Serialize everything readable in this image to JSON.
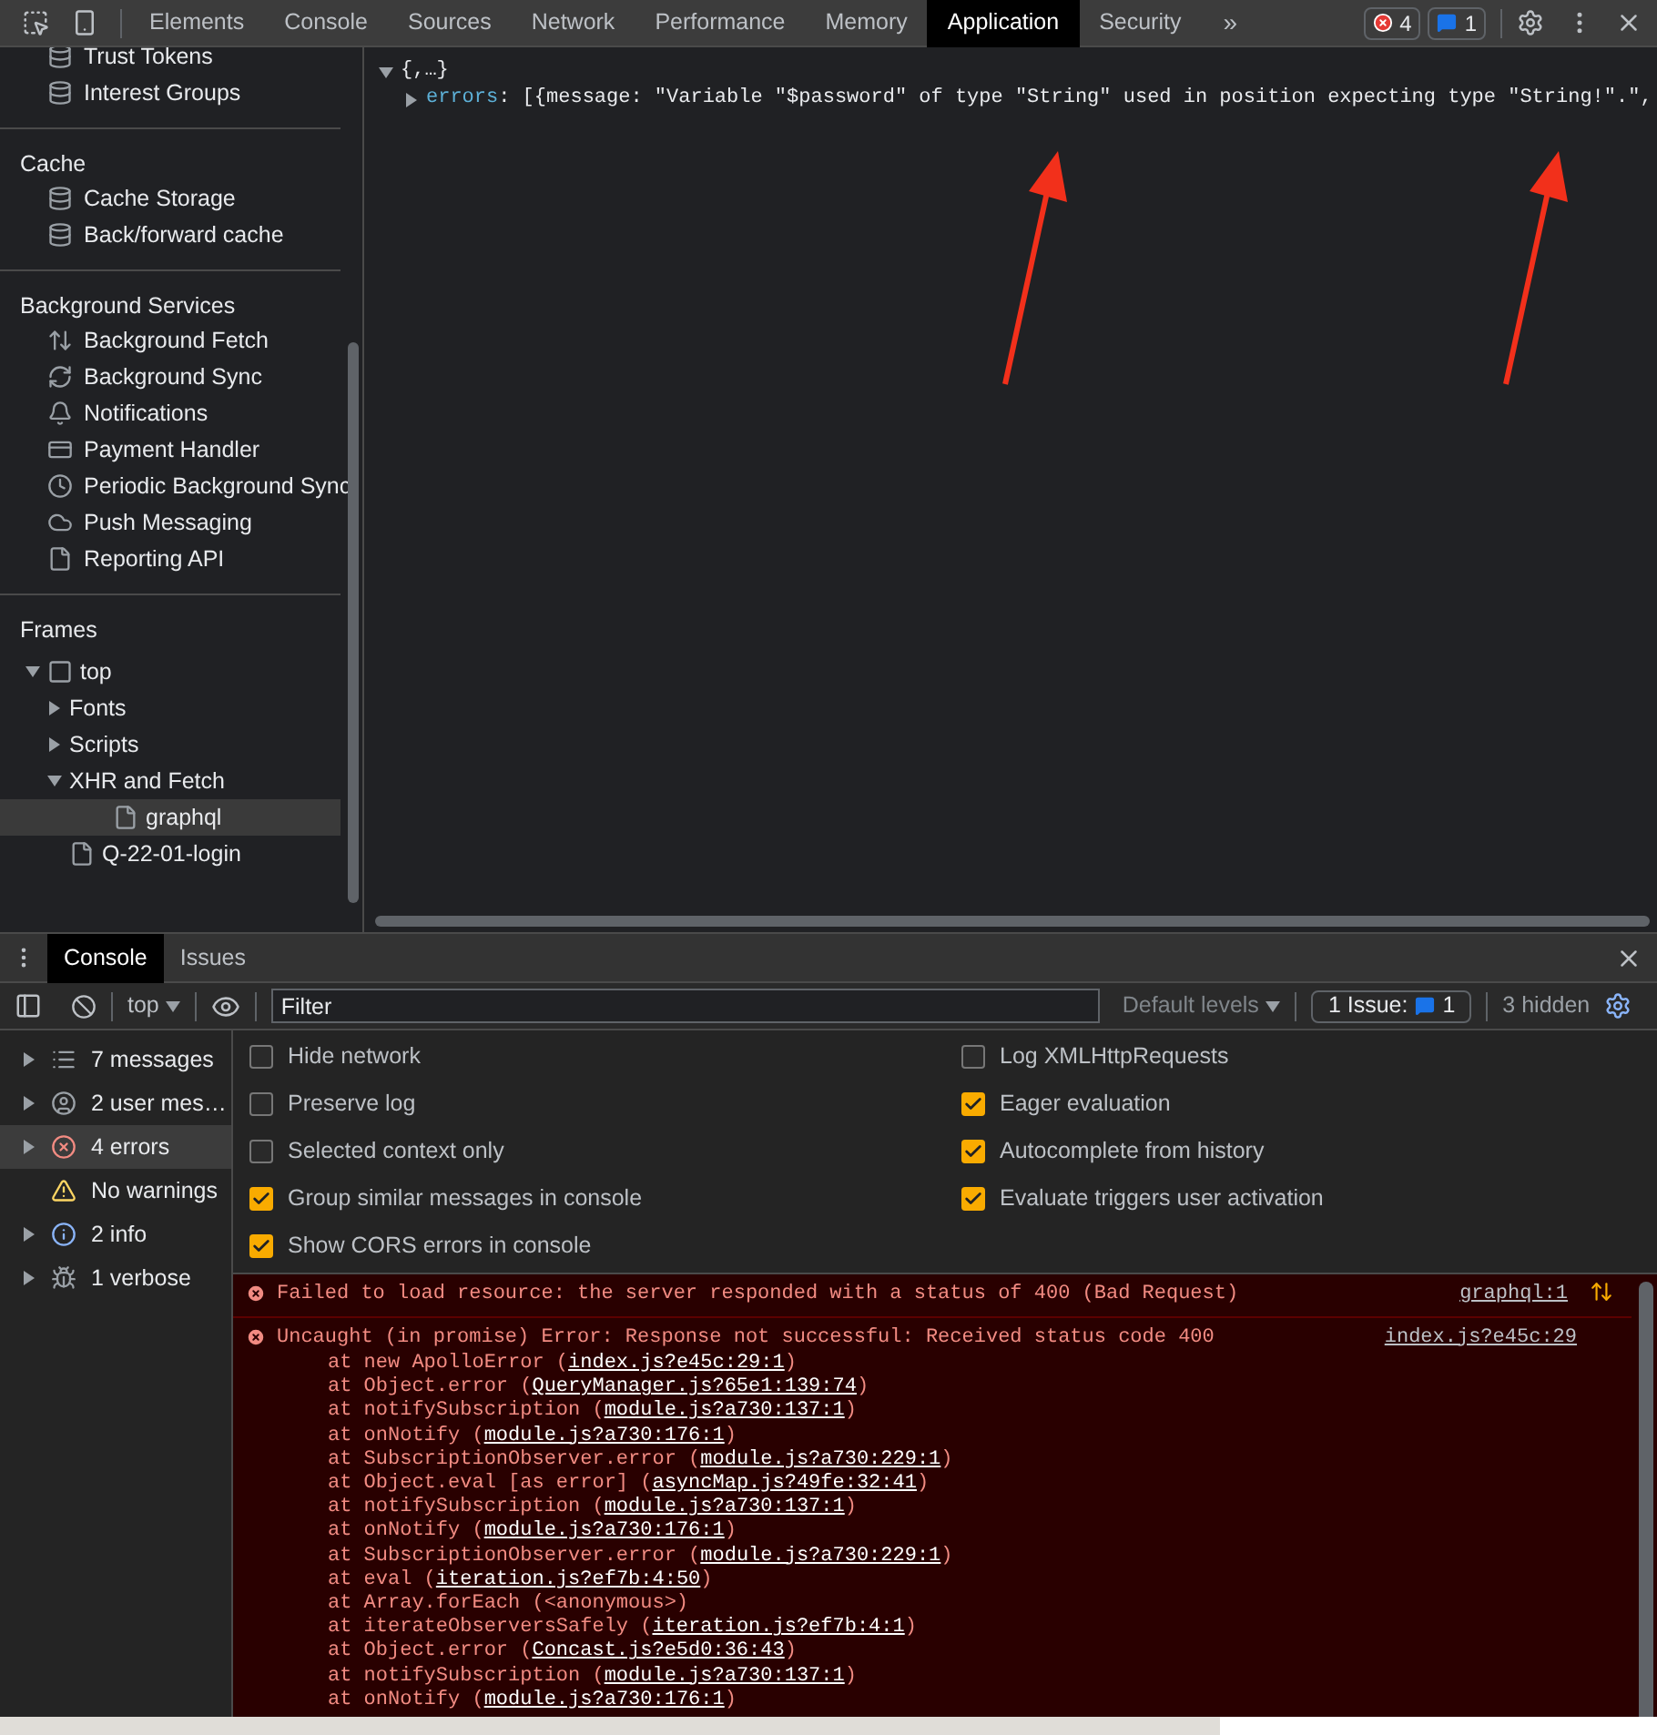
{
  "toolbar": {
    "tabs": [
      {
        "label": "Elements",
        "selected": false
      },
      {
        "label": "Console",
        "selected": false
      },
      {
        "label": "Sources",
        "selected": false
      },
      {
        "label": "Network",
        "selected": false
      },
      {
        "label": "Performance",
        "selected": false
      },
      {
        "label": "Memory",
        "selected": false
      },
      {
        "label": "Application",
        "selected": true
      },
      {
        "label": "Security",
        "selected": false
      }
    ],
    "more": "»",
    "error_count": "4",
    "issue_count": "1"
  },
  "sidebar": {
    "sections": [
      {
        "items": [
          {
            "label": "Trust Tokens",
            "kind": "storage"
          },
          {
            "label": "Interest Groups",
            "kind": "storage"
          }
        ]
      },
      {
        "title": "Cache",
        "items": [
          {
            "label": "Cache Storage",
            "kind": "storage"
          },
          {
            "label": "Back/forward cache",
            "kind": "storage"
          }
        ]
      },
      {
        "title": "Background Services",
        "items": [
          {
            "label": "Background Fetch",
            "kind": "fetch"
          },
          {
            "label": "Background Sync",
            "kind": "sync"
          },
          {
            "label": "Notifications",
            "kind": "bell"
          },
          {
            "label": "Payment Handler",
            "kind": "card"
          },
          {
            "label": "Periodic Background Sync",
            "kind": "clock"
          },
          {
            "label": "Push Messaging",
            "kind": "cloud"
          },
          {
            "label": "Reporting API",
            "kind": "file"
          }
        ]
      }
    ],
    "frames": {
      "title": "Frames",
      "tree": [
        {
          "label": "top",
          "kind": "frame",
          "expanded": true,
          "selected": false,
          "children": [
            {
              "label": "Fonts",
              "kind": "folder",
              "expanded": false,
              "selected": false
            },
            {
              "label": "Scripts",
              "kind": "folder",
              "expanded": false,
              "selected": false
            },
            {
              "label": "XHR and Fetch",
              "kind": "folder",
              "expanded": true,
              "selected": false,
              "children": [
                {
                  "label": "graphql",
                  "kind": "file",
                  "selected": true
                }
              ]
            },
            {
              "label": "Q-22-01-login",
              "kind": "file",
              "selected": false
            }
          ]
        }
      ]
    }
  },
  "preview": {
    "root": "{,…}",
    "expanded": true,
    "children": [
      {
        "key": "errors",
        "value": ": [{message: \"Variable \"$password\" of type \"String\" used in position expecting type \"String!\".\",",
        "expanded": false
      }
    ]
  },
  "drawer": {
    "tabs": [
      {
        "label": "Console",
        "selected": true
      },
      {
        "label": "Issues",
        "selected": false
      }
    ],
    "context": "top",
    "filter_placeholder": "Filter",
    "levels": "Default levels",
    "issues_label": "1 Issue:",
    "issues_count": "1",
    "hidden": "3 hidden",
    "filters": [
      {
        "label": "7 messages",
        "kind": "messages",
        "expandable": true,
        "selected": false
      },
      {
        "label": "2 user mes…",
        "kind": "user",
        "expandable": true,
        "selected": false
      },
      {
        "label": "4 errors",
        "kind": "error",
        "expandable": true,
        "selected": true
      },
      {
        "label": "No warnings",
        "kind": "warning",
        "expandable": false,
        "selected": false
      },
      {
        "label": "2 info",
        "kind": "info",
        "expandable": true,
        "selected": false
      },
      {
        "label": "1 verbose",
        "kind": "verbose",
        "expandable": true,
        "selected": false
      }
    ],
    "settings_left": [
      {
        "label": "Hide network",
        "checked": false
      },
      {
        "label": "Preserve log",
        "checked": false
      },
      {
        "label": "Selected context only",
        "checked": false
      },
      {
        "label": "Group similar messages in console",
        "checked": true
      },
      {
        "label": "Show CORS errors in console",
        "checked": true
      }
    ],
    "settings_right": [
      {
        "label": "Log XMLHttpRequests",
        "checked": false
      },
      {
        "label": "Eager evaluation",
        "checked": true
      },
      {
        "label": "Autocomplete from history",
        "checked": true
      },
      {
        "label": "Evaluate triggers user activation",
        "checked": true
      }
    ],
    "messages": [
      {
        "kind": "network",
        "text": "Failed to load resource: the server responded with a status of 400 (Bad Request)",
        "source": "graphql:1"
      },
      {
        "kind": "exception",
        "text": "Uncaught (in promise) Error: Response not successful: Received status code 400",
        "source": "index.js?e45c:29",
        "stack": [
          {
            "prefix": "at new ApolloError (",
            "link": "index.js?e45c:29:1",
            "suffix": ")"
          },
          {
            "prefix": "at Object.error (",
            "link": "QueryManager.js?65e1:139:74",
            "suffix": ")"
          },
          {
            "prefix": "at notifySubscription (",
            "link": "module.js?a730:137:1",
            "suffix": ")"
          },
          {
            "prefix": "at onNotify (",
            "link": "module.js?a730:176:1",
            "suffix": ")"
          },
          {
            "prefix": "at SubscriptionObserver.error (",
            "link": "module.js?a730:229:1",
            "suffix": ")"
          },
          {
            "prefix": "at Object.eval [as error] (",
            "link": "asyncMap.js?49fe:32:41",
            "suffix": ")"
          },
          {
            "prefix": "at notifySubscription (",
            "link": "module.js?a730:137:1",
            "suffix": ")"
          },
          {
            "prefix": "at onNotify (",
            "link": "module.js?a730:176:1",
            "suffix": ")"
          },
          {
            "prefix": "at SubscriptionObserver.error (",
            "link": "module.js?a730:229:1",
            "suffix": ")"
          },
          {
            "prefix": "at eval (",
            "link": "iteration.js?ef7b:4:50",
            "suffix": ")"
          },
          {
            "prefix": "at Array.forEach (<anonymous>)"
          },
          {
            "prefix": "at iterateObserversSafely (",
            "link": "iteration.js?ef7b:4:1",
            "suffix": ")"
          },
          {
            "prefix": "at Object.error (",
            "link": "Concast.js?e5d0:36:43",
            "suffix": ")"
          },
          {
            "prefix": "at notifySubscription (",
            "link": "module.js?a730:137:1",
            "suffix": ")"
          },
          {
            "prefix": "at onNotify (",
            "link": "module.js?a730:176:1",
            "suffix": ")"
          }
        ]
      }
    ]
  }
}
